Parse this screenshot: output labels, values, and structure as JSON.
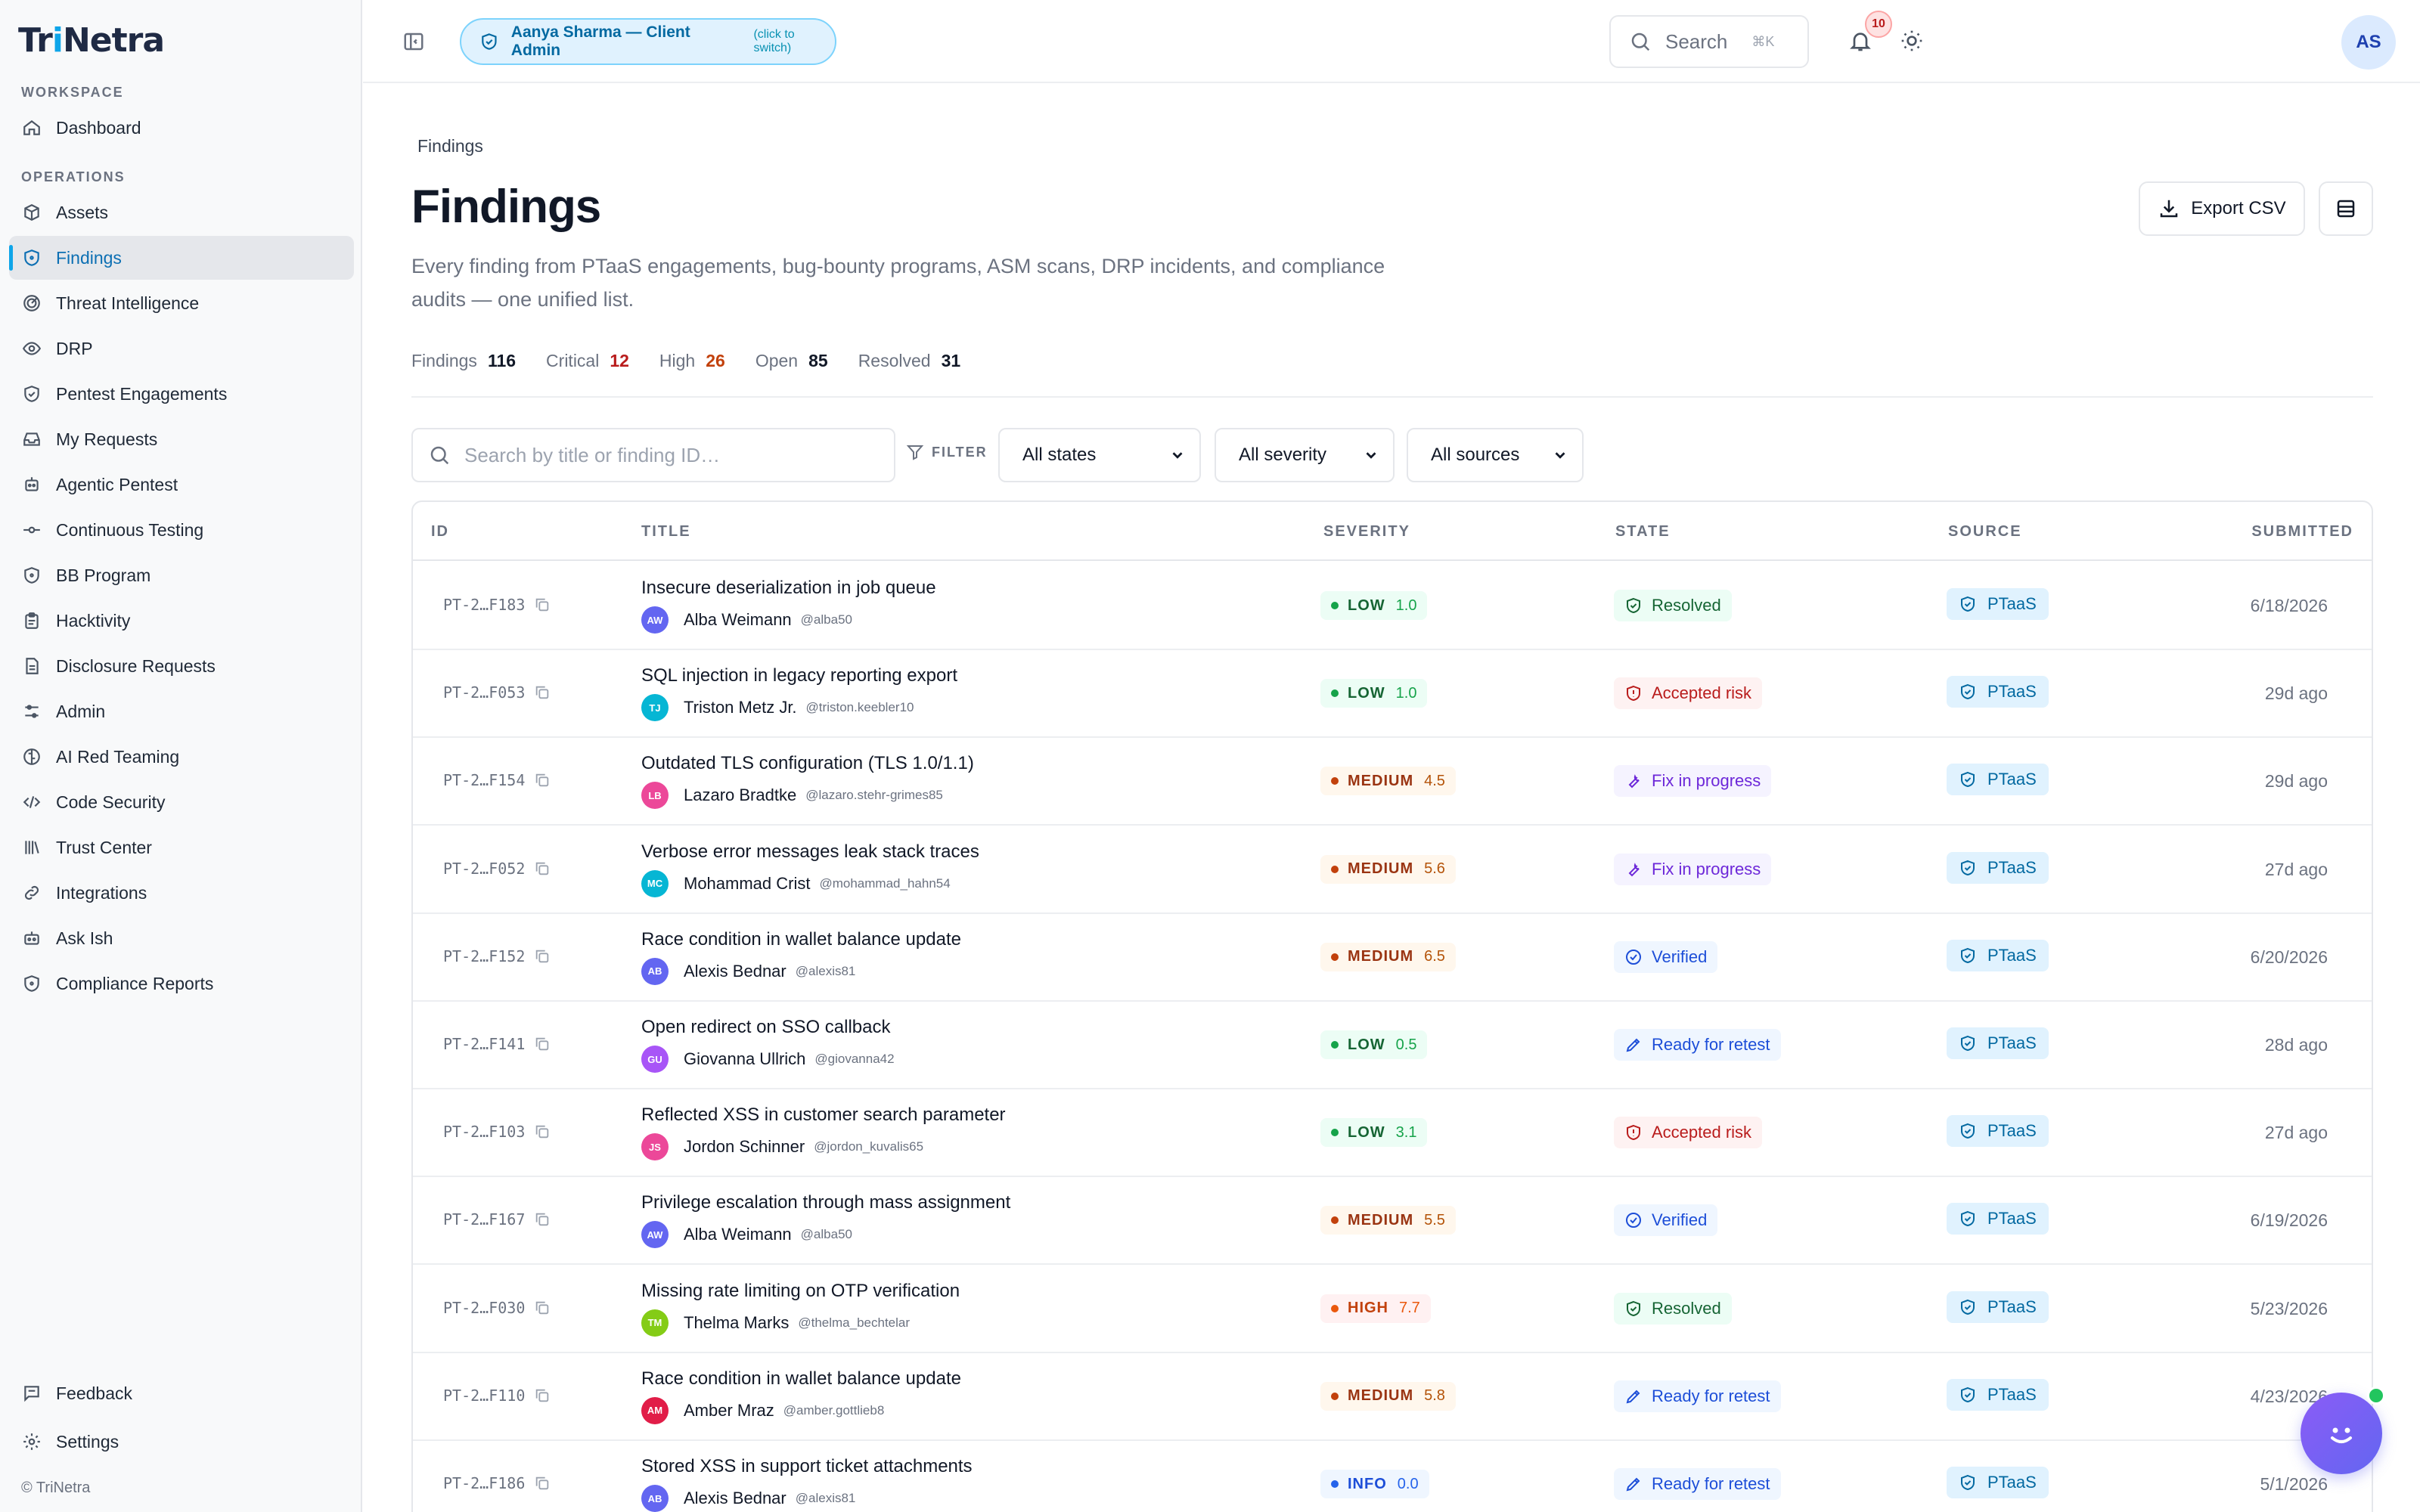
{
  "brand": {
    "logo_pre": "Tr",
    "logo_accent": "i",
    "logo_post": "Netra",
    "copyright": "© TriNetra"
  },
  "sidebar": {
    "workspace_label": "WORKSPACE",
    "operations_label": "OPERATIONS",
    "items": [
      {
        "label": "Dashboard",
        "icon": "home-icon"
      },
      {
        "label": "Assets",
        "icon": "box-icon"
      },
      {
        "label": "Findings",
        "icon": "shield-icon",
        "active": true
      },
      {
        "label": "Threat Intelligence",
        "icon": "radar-icon"
      },
      {
        "label": "DRP",
        "icon": "eye-icon"
      },
      {
        "label": "Pentest Engagements",
        "icon": "shield-check-icon"
      },
      {
        "label": "My Requests",
        "icon": "inbox-icon"
      },
      {
        "label": "Agentic Pentest",
        "icon": "bot-icon"
      },
      {
        "label": "Continuous Testing",
        "icon": "commit-icon"
      },
      {
        "label": "BB Program",
        "icon": "shield-icon"
      },
      {
        "label": "Hacktivity",
        "icon": "clipboard-icon"
      },
      {
        "label": "Disclosure Requests",
        "icon": "document-icon"
      },
      {
        "label": "Admin",
        "icon": "sliders-icon"
      },
      {
        "label": "AI Red Teaming",
        "icon": "brain-icon"
      },
      {
        "label": "Code Security",
        "icon": "code-icon"
      },
      {
        "label": "Trust Center",
        "icon": "library-icon"
      },
      {
        "label": "Integrations",
        "icon": "link-icon"
      },
      {
        "label": "Ask Ish",
        "icon": "robot-icon"
      },
      {
        "label": "Compliance Reports",
        "icon": "shield-icon"
      }
    ],
    "footer_items": [
      {
        "label": "Feedback",
        "icon": "message-icon"
      },
      {
        "label": "Settings",
        "icon": "gear-icon"
      }
    ]
  },
  "topbar": {
    "client_name": "Aanya Sharma — Client Admin",
    "client_hint": "(click to switch)",
    "search_label": "Search",
    "search_kbd": "⌘K",
    "notifications": "10",
    "avatar_initials": "AS"
  },
  "page": {
    "breadcrumb": "Findings",
    "title": "Findings",
    "description": "Every finding from PTaaS engagements, bug-bounty programs, ASM scans, DRP incidents, and compliance audits — one unified list.",
    "export_label": "Export CSV"
  },
  "stats": [
    {
      "label": "Findings",
      "value": "116"
    },
    {
      "label": "Critical",
      "value": "12"
    },
    {
      "label": "High",
      "value": "26"
    },
    {
      "label": "Open",
      "value": "85"
    },
    {
      "label": "Resolved",
      "value": "31"
    }
  ],
  "filters": {
    "search_placeholder": "Search by title or finding ID…",
    "filter_label": "FILTER",
    "state": "All states",
    "severity": "All severity",
    "source": "All sources"
  },
  "table": {
    "headers": {
      "id": "ID",
      "title": "TITLE",
      "severity": "SEVERITY",
      "state": "STATE",
      "source": "SOURCE",
      "submitted": "SUBMITTED"
    },
    "rows": [
      {
        "id": "PT-2…F183",
        "title": "Insecure deserialization in job queue",
        "initials": "AW",
        "avatar_color": "#6366f1",
        "user": "Alba Weimann",
        "handle": "@alba50",
        "sev": "LOW",
        "sev_class": "low",
        "score": "1.0",
        "state": "Resolved",
        "state_class": "resolved",
        "source": "PTaaS",
        "submitted": "6/18/2026"
      },
      {
        "id": "PT-2…F053",
        "title": "SQL injection in legacy reporting export",
        "initials": "TJ",
        "avatar_color": "#06b6d4",
        "user": "Triston Metz Jr.",
        "handle": "@triston.keebler10",
        "sev": "LOW",
        "sev_class": "low",
        "score": "1.0",
        "state": "Accepted risk",
        "state_class": "accepted",
        "source": "PTaaS",
        "submitted": "29d ago"
      },
      {
        "id": "PT-2…F154",
        "title": "Outdated TLS configuration (TLS 1.0/1.1)",
        "initials": "LB",
        "avatar_color": "#ec4899",
        "user": "Lazaro Bradtke",
        "handle": "@lazaro.stehr-grimes85",
        "sev": "MEDIUM",
        "sev_class": "medium",
        "score": "4.5",
        "state": "Fix in progress",
        "state_class": "fix",
        "source": "PTaaS",
        "submitted": "29d ago"
      },
      {
        "id": "PT-2…F052",
        "title": "Verbose error messages leak stack traces",
        "initials": "MC",
        "avatar_color": "#06b6d4",
        "user": "Mohammad Crist",
        "handle": "@mohammad_hahn54",
        "sev": "MEDIUM",
        "sev_class": "medium",
        "score": "5.6",
        "state": "Fix in progress",
        "state_class": "fix",
        "source": "PTaaS",
        "submitted": "27d ago"
      },
      {
        "id": "PT-2…F152",
        "title": "Race condition in wallet balance update",
        "initials": "AB",
        "avatar_color": "#6366f1",
        "user": "Alexis Bednar",
        "handle": "@alexis81",
        "sev": "MEDIUM",
        "sev_class": "medium",
        "score": "6.5",
        "state": "Verified",
        "state_class": "verified",
        "source": "PTaaS",
        "submitted": "6/20/2026"
      },
      {
        "id": "PT-2…F141",
        "title": "Open redirect on SSO callback",
        "initials": "GU",
        "avatar_color": "#a855f7",
        "user": "Giovanna Ullrich",
        "handle": "@giovanna42",
        "sev": "LOW",
        "sev_class": "low",
        "score": "0.5",
        "state": "Ready for retest",
        "state_class": "retest",
        "source": "PTaaS",
        "submitted": "28d ago"
      },
      {
        "id": "PT-2…F103",
        "title": "Reflected XSS in customer search parameter",
        "initials": "JS",
        "avatar_color": "#ec4899",
        "user": "Jordon Schinner",
        "handle": "@jordon_kuvalis65",
        "sev": "LOW",
        "sev_class": "low",
        "score": "3.1",
        "state": "Accepted risk",
        "state_class": "accepted",
        "source": "PTaaS",
        "submitted": "27d ago"
      },
      {
        "id": "PT-2…F167",
        "title": "Privilege escalation through mass assignment",
        "initials": "AW",
        "avatar_color": "#6366f1",
        "user": "Alba Weimann",
        "handle": "@alba50",
        "sev": "MEDIUM",
        "sev_class": "medium",
        "score": "5.5",
        "state": "Verified",
        "state_class": "verified",
        "source": "PTaaS",
        "submitted": "6/19/2026"
      },
      {
        "id": "PT-2…F030",
        "title": "Missing rate limiting on OTP verification",
        "initials": "TM",
        "avatar_color": "#84cc16",
        "user": "Thelma Marks",
        "handle": "@thelma_bechtelar",
        "sev": "HIGH",
        "sev_class": "high",
        "score": "7.7",
        "state": "Resolved",
        "state_class": "resolved",
        "source": "PTaaS",
        "submitted": "5/23/2026"
      },
      {
        "id": "PT-2…F110",
        "title": "Race condition in wallet balance update",
        "initials": "AM",
        "avatar_color": "#e11d48",
        "user": "Amber Mraz",
        "handle": "@amber.gottlieb8",
        "sev": "MEDIUM",
        "sev_class": "medium",
        "score": "5.8",
        "state": "Ready for retest",
        "state_class": "retest",
        "source": "PTaaS",
        "submitted": "4/23/2026"
      },
      {
        "id": "PT-2…F186",
        "title": "Stored XSS in support ticket attachments",
        "initials": "AB",
        "avatar_color": "#6366f1",
        "user": "Alexis Bednar",
        "handle": "@alexis81",
        "sev": "INFO",
        "sev_class": "info",
        "score": "0.0",
        "state": "Ready for retest",
        "state_class": "retest",
        "source": "PTaaS",
        "submitted": "5/1/2026"
      }
    ]
  }
}
